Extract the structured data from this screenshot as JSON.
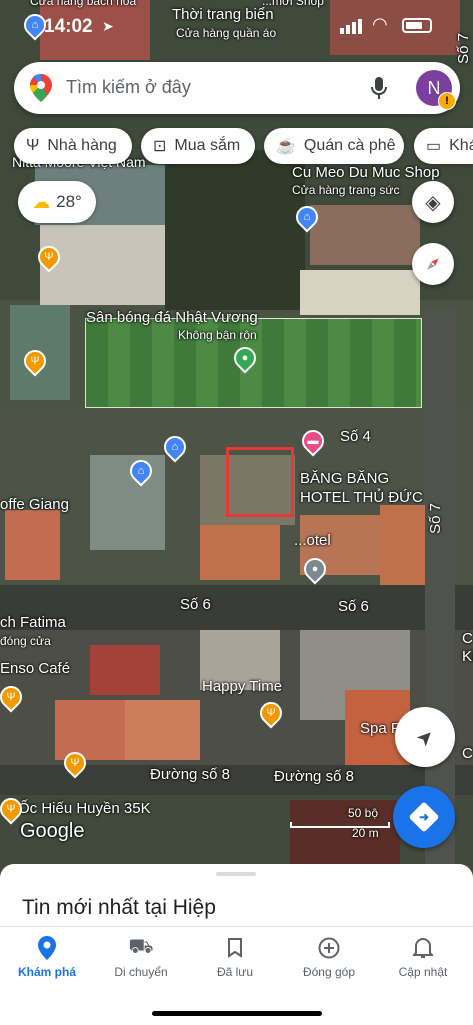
{
  "status": {
    "time": "14:02"
  },
  "search": {
    "placeholder": "Tìm kiếm ở đây",
    "avatar_letter": "N",
    "alert": "!"
  },
  "chips": [
    {
      "label": "Nhà hàng"
    },
    {
      "label": "Mua sắm"
    },
    {
      "label": "Quán cà phê"
    },
    {
      "label": "Khá"
    }
  ],
  "weather": {
    "temp": "28°"
  },
  "map_labels": {
    "top_shop": "Thời trang biển",
    "top_shop_sub": "Cửa hàng quần áo",
    "top_left_sub": "Cửa hàng bách hóa",
    "top_right_shop": "Cu Meo Du Muc Shop",
    "top_right_shop_top": "...mới Shop",
    "top_right_shop_sub": "Cửa hàng trang sức",
    "nitta": "Nitta Moore Việt Nam",
    "so7_top": "Số 7",
    "field": "Sân bóng đá Nhật Vương",
    "field_sub": "Không bận rộn",
    "so4": "Số 4",
    "hotel": "BĂNG BĂNG",
    "hotel2": "HOTEL THỦ ĐỨC",
    "hotel_partial": "...otel",
    "so7": "Số 7",
    "coffee": "offe Giang",
    "so6_left": "Số 6",
    "so6_right": "Số 6",
    "fatima": "ch Fatima",
    "fatima_sub": "đóng cửa",
    "enso": "Enso Café",
    "happy": "Happy Time",
    "spa": "Spa F",
    "duong8_left": "Đường số 8",
    "duong8_right": "Đường số 8",
    "oc": "Ốc Hiếu Huyền 35K",
    "google": "Google",
    "scale_ft": "50 bộ",
    "scale_m": "20 m",
    "right_c": "C",
    "right_k": "Ki",
    "right_c2": "C"
  },
  "sheet": {
    "title": "Tin mới nhất tại Hiệp"
  },
  "nav": [
    {
      "label": "Khám phá",
      "icon": "explore-pin-icon",
      "active": true
    },
    {
      "label": "Di chuyển",
      "icon": "commute-icon",
      "active": false
    },
    {
      "label": "Đã lưu",
      "icon": "bookmark-icon",
      "active": false
    },
    {
      "label": "Đóng góp",
      "icon": "add-circle-icon",
      "active": false
    },
    {
      "label": "Cập nhật",
      "icon": "bell-icon",
      "active": false
    }
  ],
  "colors": {
    "accent": "#1a73e8",
    "food_pin": "#f29900",
    "shop_pin": "#4285f4",
    "hotel_pin": "#ea4c89",
    "park_pin": "#34a853"
  }
}
